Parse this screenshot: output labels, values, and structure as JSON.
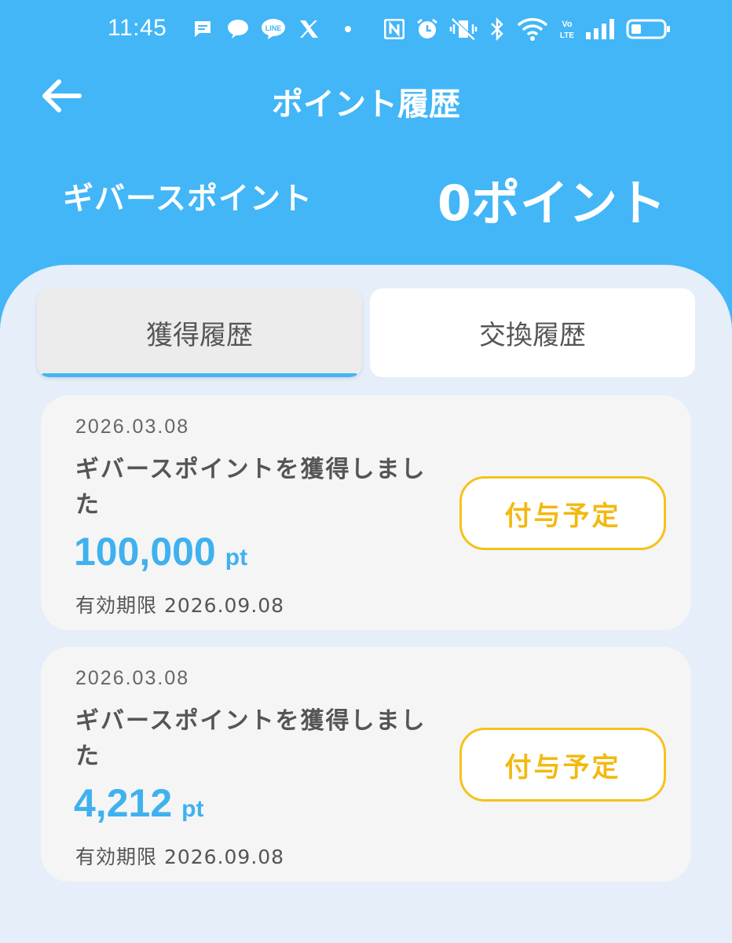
{
  "status_bar": {
    "time": "11:45"
  },
  "header": {
    "title": "ポイント履歴",
    "points_label": "ギバースポイント",
    "points_value": "0ポイント"
  },
  "tabs": [
    {
      "label": "獲得履歴",
      "selected": true
    },
    {
      "label": "交換履歴",
      "selected": false
    }
  ],
  "history": [
    {
      "date": "2026.03.08",
      "description": "ギバースポイントを獲得しました",
      "amount": "100,000",
      "unit": "pt",
      "expiry": "有効期限 2026.09.08",
      "status": "付与予定"
    },
    {
      "date": "2026.03.08",
      "description": "ギバースポイントを獲得しました",
      "amount": "4,212",
      "unit": "pt",
      "expiry": "有効期限 2026.09.08",
      "status": "付与予定"
    }
  ],
  "colors": {
    "header_bg": "#42b6f7",
    "accent": "#42b6f7",
    "amount": "#3fb1ee",
    "badge": "#f5c21b",
    "page_bg": "#e5eef9"
  }
}
